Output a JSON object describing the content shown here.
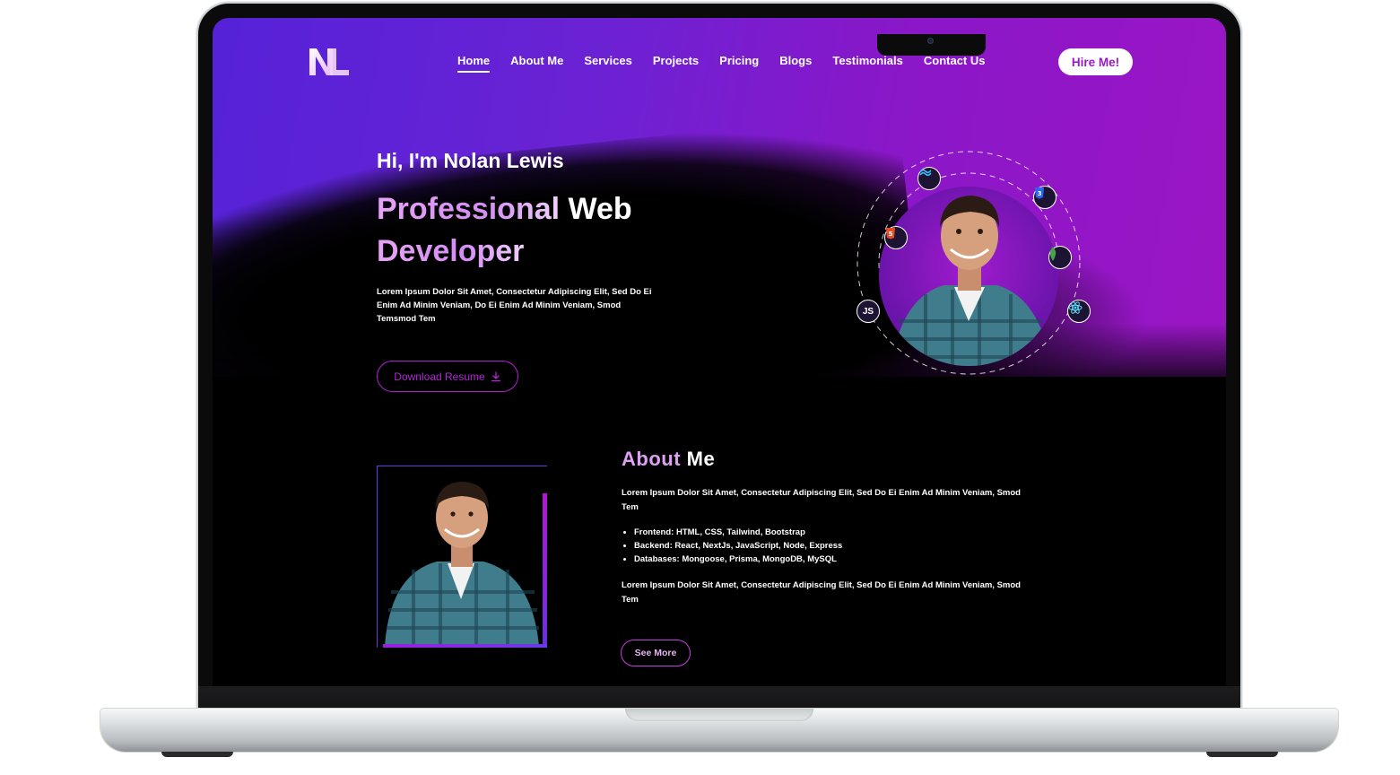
{
  "brand": {
    "logo_text": "NL"
  },
  "nav": {
    "items": [
      {
        "label": "Home",
        "active": true
      },
      {
        "label": "About Me",
        "active": false
      },
      {
        "label": "Services",
        "active": false
      },
      {
        "label": "Projects",
        "active": false
      },
      {
        "label": "Pricing",
        "active": false
      },
      {
        "label": "Blogs",
        "active": false
      },
      {
        "label": "Testimonials",
        "active": false
      },
      {
        "label": "Contact Us",
        "active": false
      }
    ],
    "hire_label": "Hire Me!"
  },
  "hero": {
    "greeting": "Hi, I'm Nolan Lewis",
    "headline_part1": "Professional",
    "headline_part2": " Web",
    "headline_part3": "Developer",
    "description": "Lorem Ipsum Dolor Sit Amet, Consectetur Adipiscing Elit, Sed Do Ei Enim Ad Minim Veniam, Do Ei Enim Ad Minim Veniam, Smod Temsmod Tem",
    "resume_label": "Download Resume",
    "tech_icons": [
      "tailwind-icon",
      "css3-icon",
      "html5-icon",
      "mongodb-icon",
      "javascript-icon",
      "react-icon"
    ],
    "js_label": "JS"
  },
  "about": {
    "title_part1": "About",
    "title_part2": " Me",
    "paragraph1": "Lorem Ipsum Dolor Sit Amet, Consectetur Adipiscing Elit, Sed Do Ei Enim Ad Minim Veniam, Smod Tem",
    "skills": [
      "Frontend: HTML, CSS, Tailwind, Bootstrap",
      "Backend: React, NextJs, JavaScript, Node, Express",
      "Databases: Mongoose, Prisma, MongoDB, MySQL"
    ],
    "paragraph2": "Lorem Ipsum Dolor Sit Amet, Consectetur Adipiscing Elit, Sed Do Ei Enim Ad Minim Veniam, Smod Tem",
    "see_more_label": "See More"
  },
  "colors": {
    "accent": "#9b16c4",
    "gradient_start": "#5522d8",
    "headline_gradient": "#dda0f3"
  }
}
